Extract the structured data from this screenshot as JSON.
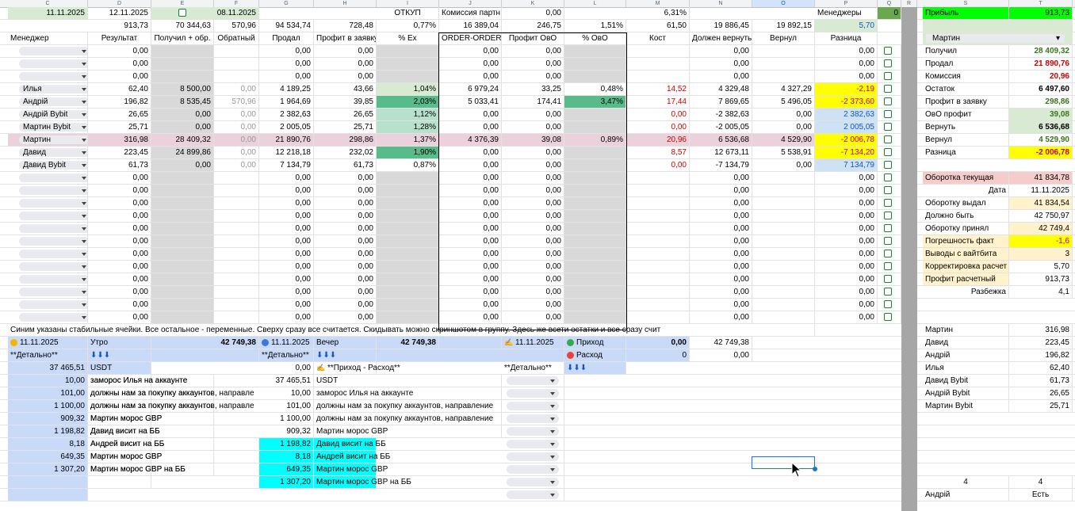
{
  "column_headers": [
    "C",
    "D",
    "E",
    "F",
    "G",
    "H",
    "I",
    "J",
    "K",
    "L",
    "M",
    "N",
    "O",
    "P",
    "Q",
    "R",
    "S",
    "T"
  ],
  "top_row": {
    "date1": "11.11.2025",
    "date2": "12.11.2025",
    "date3": "08.11.2025",
    "otkup_label": "ОТКУП",
    "commission_label": "Комиссия партн",
    "commission_value": "0,00",
    "percent": "6,31%",
    "managers_label": "Менеджеры",
    "managers_count": "0",
    "profit_label": "Прибыль",
    "profit_value": "913,73"
  },
  "totals": [
    "913,73",
    "70 344,63",
    "570,96",
    "94 534,74",
    "728,48",
    "0,77%",
    "16 389,04",
    "246,75",
    "1,51%",
    "61,50",
    "19 886,45",
    "19 892,15",
    "5,70"
  ],
  "headers": [
    "Менеджер",
    "Результат",
    "Получил + обр.",
    "Обратный",
    "Продал",
    "Профит в заявку",
    "% Ex",
    "ORDER-ORDER",
    "Профит ОвО",
    "% ОвО",
    "Кост",
    "Должен вернуть",
    "Вернул",
    "Разница"
  ],
  "rows": [
    {
      "name": "",
      "res": "0,00",
      "rec": "",
      "rev": "",
      "sold": "0,00",
      "prof": "0,00",
      "pex": "",
      "oo": "0,00",
      "povo": "0,00",
      "pct": "",
      "cost": "",
      "owe": "0,00",
      "ret": "",
      "diff": "0,00"
    },
    {
      "name": "",
      "res": "0,00",
      "rec": "",
      "rev": "",
      "sold": "0,00",
      "prof": "0,00",
      "pex": "",
      "oo": "0,00",
      "povo": "0,00",
      "pct": "",
      "cost": "",
      "owe": "0,00",
      "ret": "",
      "diff": "0,00"
    },
    {
      "name": "",
      "res": "0,00",
      "rec": "",
      "rev": "",
      "sold": "0,00",
      "prof": "0,00",
      "pex": "",
      "oo": "0,00",
      "povo": "0,00",
      "pct": "",
      "cost": "",
      "owe": "0,00",
      "ret": "",
      "diff": "0,00"
    },
    {
      "name": "Илья",
      "res": "62,40",
      "rec": "8 500,00",
      "rev": "0,00",
      "sold": "4 189,25",
      "prof": "43,66",
      "pex": "1,04%",
      "oo": "6 979,24",
      "povo": "33,25",
      "pct": "0,48%",
      "cost": "14,52",
      "owe": "4 329,48",
      "ret": "4 327,29",
      "diff": "-2,19"
    },
    {
      "name": "Андрій",
      "res": "196,82",
      "rec": "8 535,45",
      "rev": "570,96",
      "sold": "1 964,69",
      "prof": "39,85",
      "pex": "2,03%",
      "oo": "5 033,41",
      "povo": "174,41",
      "pct": "3,47%",
      "cost": "17,44",
      "owe": "7 869,65",
      "ret": "5 496,05",
      "diff": "-2 373,60"
    },
    {
      "name": "Андрій Bybit",
      "res": "26,65",
      "rec": "0,00",
      "rev": "0,00",
      "sold": "2 382,63",
      "prof": "26,65",
      "pex": "1,12%",
      "oo": "0,00",
      "povo": "0,00",
      "pct": "",
      "cost": "0,00",
      "owe": "-2 382,63",
      "ret": "0,00",
      "diff": "2 382,63"
    },
    {
      "name": "Мартин Bybit",
      "res": "25,71",
      "rec": "0,00",
      "rev": "0,00",
      "sold": "2 005,05",
      "prof": "25,71",
      "pex": "1,28%",
      "oo": "0,00",
      "povo": "0,00",
      "pct": "",
      "cost": "0,00",
      "owe": "-2 005,05",
      "ret": "0,00",
      "diff": "2 005,05"
    },
    {
      "name": "Мартин",
      "res": "316,98",
      "rec": "28 409,32",
      "rev": "0,00",
      "sold": "21 890,76",
      "prof": "298,86",
      "pex": "1,37%",
      "oo": "4 376,39",
      "povo": "39,08",
      "pct": "0,89%",
      "cost": "20,96",
      "owe": "6 536,68",
      "ret": "4 529,90",
      "diff": "-2 006,78"
    },
    {
      "name": "Давид",
      "res": "223,45",
      "rec": "24 899,86",
      "rev": "0,00",
      "sold": "12 218,18",
      "prof": "232,02",
      "pex": "1,90%",
      "oo": "0,00",
      "povo": "0,00",
      "pct": "",
      "cost": "8,57",
      "owe": "12 673,11",
      "ret": "5 538,91",
      "diff": "-7 134,20"
    },
    {
      "name": "Давид Bybit",
      "res": "61,73",
      "rec": "0,00",
      "rev": "0,00",
      "sold": "7 134,79",
      "prof": "61,73",
      "pex": "0,87%",
      "oo": "0,00",
      "povo": "0,00",
      "pct": "",
      "cost": "0,00",
      "owe": "-7 134,79",
      "ret": "0,00",
      "diff": "7 134,79"
    },
    {
      "name": "",
      "res": "0,00",
      "rec": "",
      "rev": "",
      "sold": "0,00",
      "prof": "0,00",
      "pex": "",
      "oo": "0,00",
      "povo": "0,00",
      "pct": "",
      "cost": "",
      "owe": "0,00",
      "ret": "",
      "diff": "0,00"
    },
    {
      "name": "",
      "res": "0,00",
      "rec": "",
      "rev": "",
      "sold": "0,00",
      "prof": "0,00",
      "pex": "",
      "oo": "0,00",
      "povo": "0,00",
      "pct": "",
      "cost": "",
      "owe": "0,00",
      "ret": "",
      "diff": "0,00"
    },
    {
      "name": "",
      "res": "0,00",
      "rec": "",
      "rev": "",
      "sold": "0,00",
      "prof": "0,00",
      "pex": "",
      "oo": "0,00",
      "povo": "0,00",
      "pct": "",
      "cost": "",
      "owe": "0,00",
      "ret": "",
      "diff": "0,00"
    },
    {
      "name": "",
      "res": "0,00",
      "rec": "",
      "rev": "",
      "sold": "0,00",
      "prof": "0,00",
      "pex": "",
      "oo": "0,00",
      "povo": "0,00",
      "pct": "",
      "cost": "",
      "owe": "0,00",
      "ret": "",
      "diff": "0,00"
    },
    {
      "name": "",
      "res": "0,00",
      "rec": "",
      "rev": "",
      "sold": "0,00",
      "prof": "0,00",
      "pex": "",
      "oo": "0,00",
      "povo": "0,00",
      "pct": "",
      "cost": "",
      "owe": "0,00",
      "ret": "",
      "diff": "0,00"
    },
    {
      "name": "",
      "res": "0,00",
      "rec": "",
      "rev": "",
      "sold": "0,00",
      "prof": "0,00",
      "pex": "",
      "oo": "0,00",
      "povo": "0,00",
      "pct": "",
      "cost": "",
      "owe": "0,00",
      "ret": "",
      "diff": "0,00"
    },
    {
      "name": "",
      "res": "0,00",
      "rec": "",
      "rev": "",
      "sold": "0,00",
      "prof": "0,00",
      "pex": "",
      "oo": "0,00",
      "povo": "0,00",
      "pct": "",
      "cost": "",
      "owe": "0,00",
      "ret": "",
      "diff": "0,00"
    },
    {
      "name": "",
      "res": "0,00",
      "rec": "",
      "rev": "",
      "sold": "0,00",
      "prof": "0,00",
      "pex": "",
      "oo": "0,00",
      "povo": "0,00",
      "pct": "",
      "cost": "",
      "owe": "0,00",
      "ret": "",
      "diff": "0,00"
    },
    {
      "name": "",
      "res": "0,00",
      "rec": "",
      "rev": "",
      "sold": "0,00",
      "prof": "0,00",
      "pex": "",
      "oo": "0,00",
      "povo": "0,00",
      "pct": "",
      "cost": "",
      "owe": "0,00",
      "ret": "",
      "diff": "0,00"
    },
    {
      "name": "",
      "res": "0,00",
      "rec": "",
      "rev": "",
      "sold": "0,00",
      "prof": "0,00",
      "pex": "",
      "oo": "0,00",
      "povo": "0,00",
      "pct": "",
      "cost": "",
      "owe": "0,00",
      "ret": "",
      "diff": "0,00"
    },
    {
      "name": "",
      "res": "0,00",
      "rec": "",
      "rev": "",
      "sold": "0,00",
      "prof": "0,00",
      "pex": "",
      "oo": "0,00",
      "povo": "0,00",
      "pct": "",
      "cost": "",
      "owe": "0,00",
      "ret": "",
      "diff": "0,00"
    },
    {
      "name": "",
      "res": "0,00",
      "rec": "",
      "rev": "",
      "sold": "0,00",
      "prof": "0,00",
      "pex": "",
      "oo": "0,00",
      "povo": "0,00",
      "pct": "",
      "cost": "",
      "owe": "0,00",
      "ret": "",
      "diff": "0,00"
    }
  ],
  "right_panel": {
    "selector": "Мартин",
    "stats": [
      {
        "label": "Получил",
        "value": "28 409,32",
        "color": "#38761d"
      },
      {
        "label": "Продал",
        "value": "21 890,76",
        "color": "#cc0000"
      },
      {
        "label": "Комиссия",
        "value": "20,96",
        "color": "#cc0000"
      },
      {
        "label": "Остаток",
        "value": "6 497,60",
        "color": "#000000"
      },
      {
        "label": "Профит в заявку",
        "value": "298,86",
        "color": "#38761d"
      },
      {
        "label": "ОвО профит",
        "value": "39,08",
        "color": "#38761d"
      },
      {
        "label": "Вернуть",
        "value": "6 536,68",
        "color": "#000000"
      },
      {
        "label": "Вернул",
        "value": "4 529,90",
        "color": "#38761d"
      },
      {
        "label": "Разница",
        "value": "-2 006,78",
        "color": "#cc0000"
      }
    ],
    "turnover": [
      {
        "label": "Оборотка текущая",
        "value": "41 834,78"
      },
      {
        "label": "Дата",
        "value": "11.11.2025"
      },
      {
        "label": "Оборотку выдал",
        "value": "41 834,54"
      },
      {
        "label": "Должно быть",
        "value": "42 750,97"
      },
      {
        "label": "Оборотку принял",
        "value": "42 749,4"
      },
      {
        "label": "Погрешность факт",
        "value": "-1,6"
      },
      {
        "label": "Выводы с вайтбита",
        "value": "3"
      },
      {
        "label": "Корректировка расчет",
        "value": "5,70"
      },
      {
        "label": "Профит расчетный",
        "value": "913,73"
      },
      {
        "label": "Разбежка",
        "value": "4,1"
      }
    ],
    "managers": [
      {
        "name": "Мартин",
        "value": "316,98"
      },
      {
        "name": "Давид",
        "value": "223,45"
      },
      {
        "name": "Андрій",
        "value": "196,82"
      },
      {
        "name": "Илья",
        "value": "62,40"
      },
      {
        "name": "Давид Bybit",
        "value": "61,73"
      },
      {
        "name": "Андрій Bybit",
        "value": "26,65"
      },
      {
        "name": "Мартин Bybit",
        "value": "25,71"
      }
    ],
    "bottom_counts": [
      "4",
      "4"
    ],
    "bottom_name": "Андрій",
    "bottom_status": "Есть"
  },
  "note": "Синим указаны стабильные ячейки. Все остальное - переменные. Сверху сразу все считается. Скидывать можно скриншотом в группу. Здесь же всети остатки и все сразу счит",
  "morning": {
    "date": "11.11.2025",
    "label": "Утро",
    "total": "42 749,38",
    "detail": "**Детально**",
    "arrows": "⬇⬇⬇",
    "items": [
      {
        "amount": "37 465,51",
        "desc": "USDT"
      },
      {
        "amount": "10,00",
        "desc": "заморос Илья на аккаунте"
      },
      {
        "amount": "101,00",
        "desc": "должны нам за покупку аккаунтов, направле"
      },
      {
        "amount": "1 100,00",
        "desc": "должны нам за покупку аккаунтов, направле"
      },
      {
        "amount": "909,32",
        "desc": "Мартин морос GBP"
      },
      {
        "amount": "1 198,82",
        "desc": "Давид висит на ББ"
      },
      {
        "amount": "8,18",
        "desc": "Андрей висит на ББ"
      },
      {
        "amount": "649,35",
        "desc": "Мартин морос GBP"
      },
      {
        "amount": "1 307,20",
        "desc": "Мартин морос GBP на ББ"
      }
    ]
  },
  "evening": {
    "date": "11.11.2025",
    "label": "Вечер",
    "total": "42 749,38",
    "detail": "**Детально**",
    "arrows": "⬇⬇⬇",
    "zero": "0,00",
    "income_expense": "**Приход - Расход**",
    "items": [
      {
        "amount": "37 465,51",
        "desc": "USDT"
      },
      {
        "amount": "10,00",
        "desc": "заморос Илья на аккаунте"
      },
      {
        "amount": "101,00",
        "desc": "должны нам за покупку аккаунтов, направление"
      },
      {
        "amount": "1 100,00",
        "desc": "должны нам за покупку аккаунтов, направление"
      },
      {
        "amount": "909,32",
        "desc": "Мартин морос GBP"
      },
      {
        "amount": "1 198,82",
        "desc": "Давид висит на ББ"
      },
      {
        "amount": "8,18",
        "desc": "Андрей висит на ББ"
      },
      {
        "amount": "649,35",
        "desc": "Мартин морос GBP"
      },
      {
        "amount": "1 307,20",
        "desc": "Мартин морос GBP на ББ"
      }
    ]
  },
  "income": {
    "date": "11.11.2025",
    "income_label": "Приход",
    "income_value": "0,00",
    "expense_label": "Расход",
    "expense_value": "0",
    "detail": "**Детально**",
    "arrows": "⬇⬇⬇",
    "side_value1": "42 749,38",
    "side_value2": "0,00"
  }
}
